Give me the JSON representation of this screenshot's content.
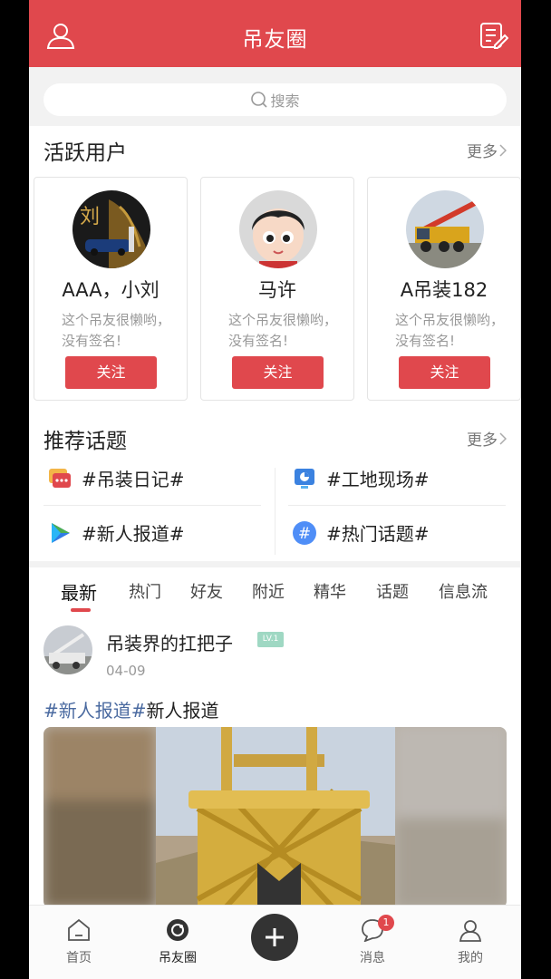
{
  "header": {
    "title": "吊友圈",
    "left_icon": "user-icon",
    "right_icon": "edit-icon",
    "color": "#e0484d"
  },
  "search": {
    "placeholder": "搜索"
  },
  "active_users": {
    "title": "活跃用户",
    "more": "更多",
    "users": [
      {
        "name": "AAA，小刘",
        "signature": "这个吊友很懒哟，没有签名!",
        "follow": "关注"
      },
      {
        "name": "马许",
        "signature": "这个吊友很懒哟，没有签名!",
        "follow": "关注"
      },
      {
        "name": "A吊装182",
        "signature": "这个吊友很懒哟，没有签名!",
        "follow": "关注"
      }
    ]
  },
  "topics": {
    "title": "推荐话题",
    "more": "更多",
    "items": [
      {
        "label": "#吊装日记#",
        "icon": "chat-icon"
      },
      {
        "label": "#工地现场#",
        "icon": "chart-icon"
      },
      {
        "label": "#新人报道#",
        "icon": "play-icon"
      },
      {
        "label": "#热门话题#",
        "icon": "hash-icon"
      }
    ]
  },
  "feed": {
    "tabs": [
      "最新",
      "热门",
      "好友",
      "附近",
      "精华",
      "话题",
      "信息流"
    ],
    "active_tab": "最新",
    "post": {
      "author": "吊装界的扛把子",
      "level": "LV.1",
      "date": "04-09",
      "tag": "#新人报道#",
      "text": "新人报道"
    }
  },
  "bottom_nav": {
    "items": [
      {
        "label": "首页",
        "icon": "home-icon"
      },
      {
        "label": "吊友圈",
        "icon": "circle-icon"
      },
      {
        "label": "",
        "icon": "plus-icon"
      },
      {
        "label": "消息",
        "icon": "message-icon",
        "badge": "1"
      },
      {
        "label": "我的",
        "icon": "profile-icon"
      }
    ]
  }
}
